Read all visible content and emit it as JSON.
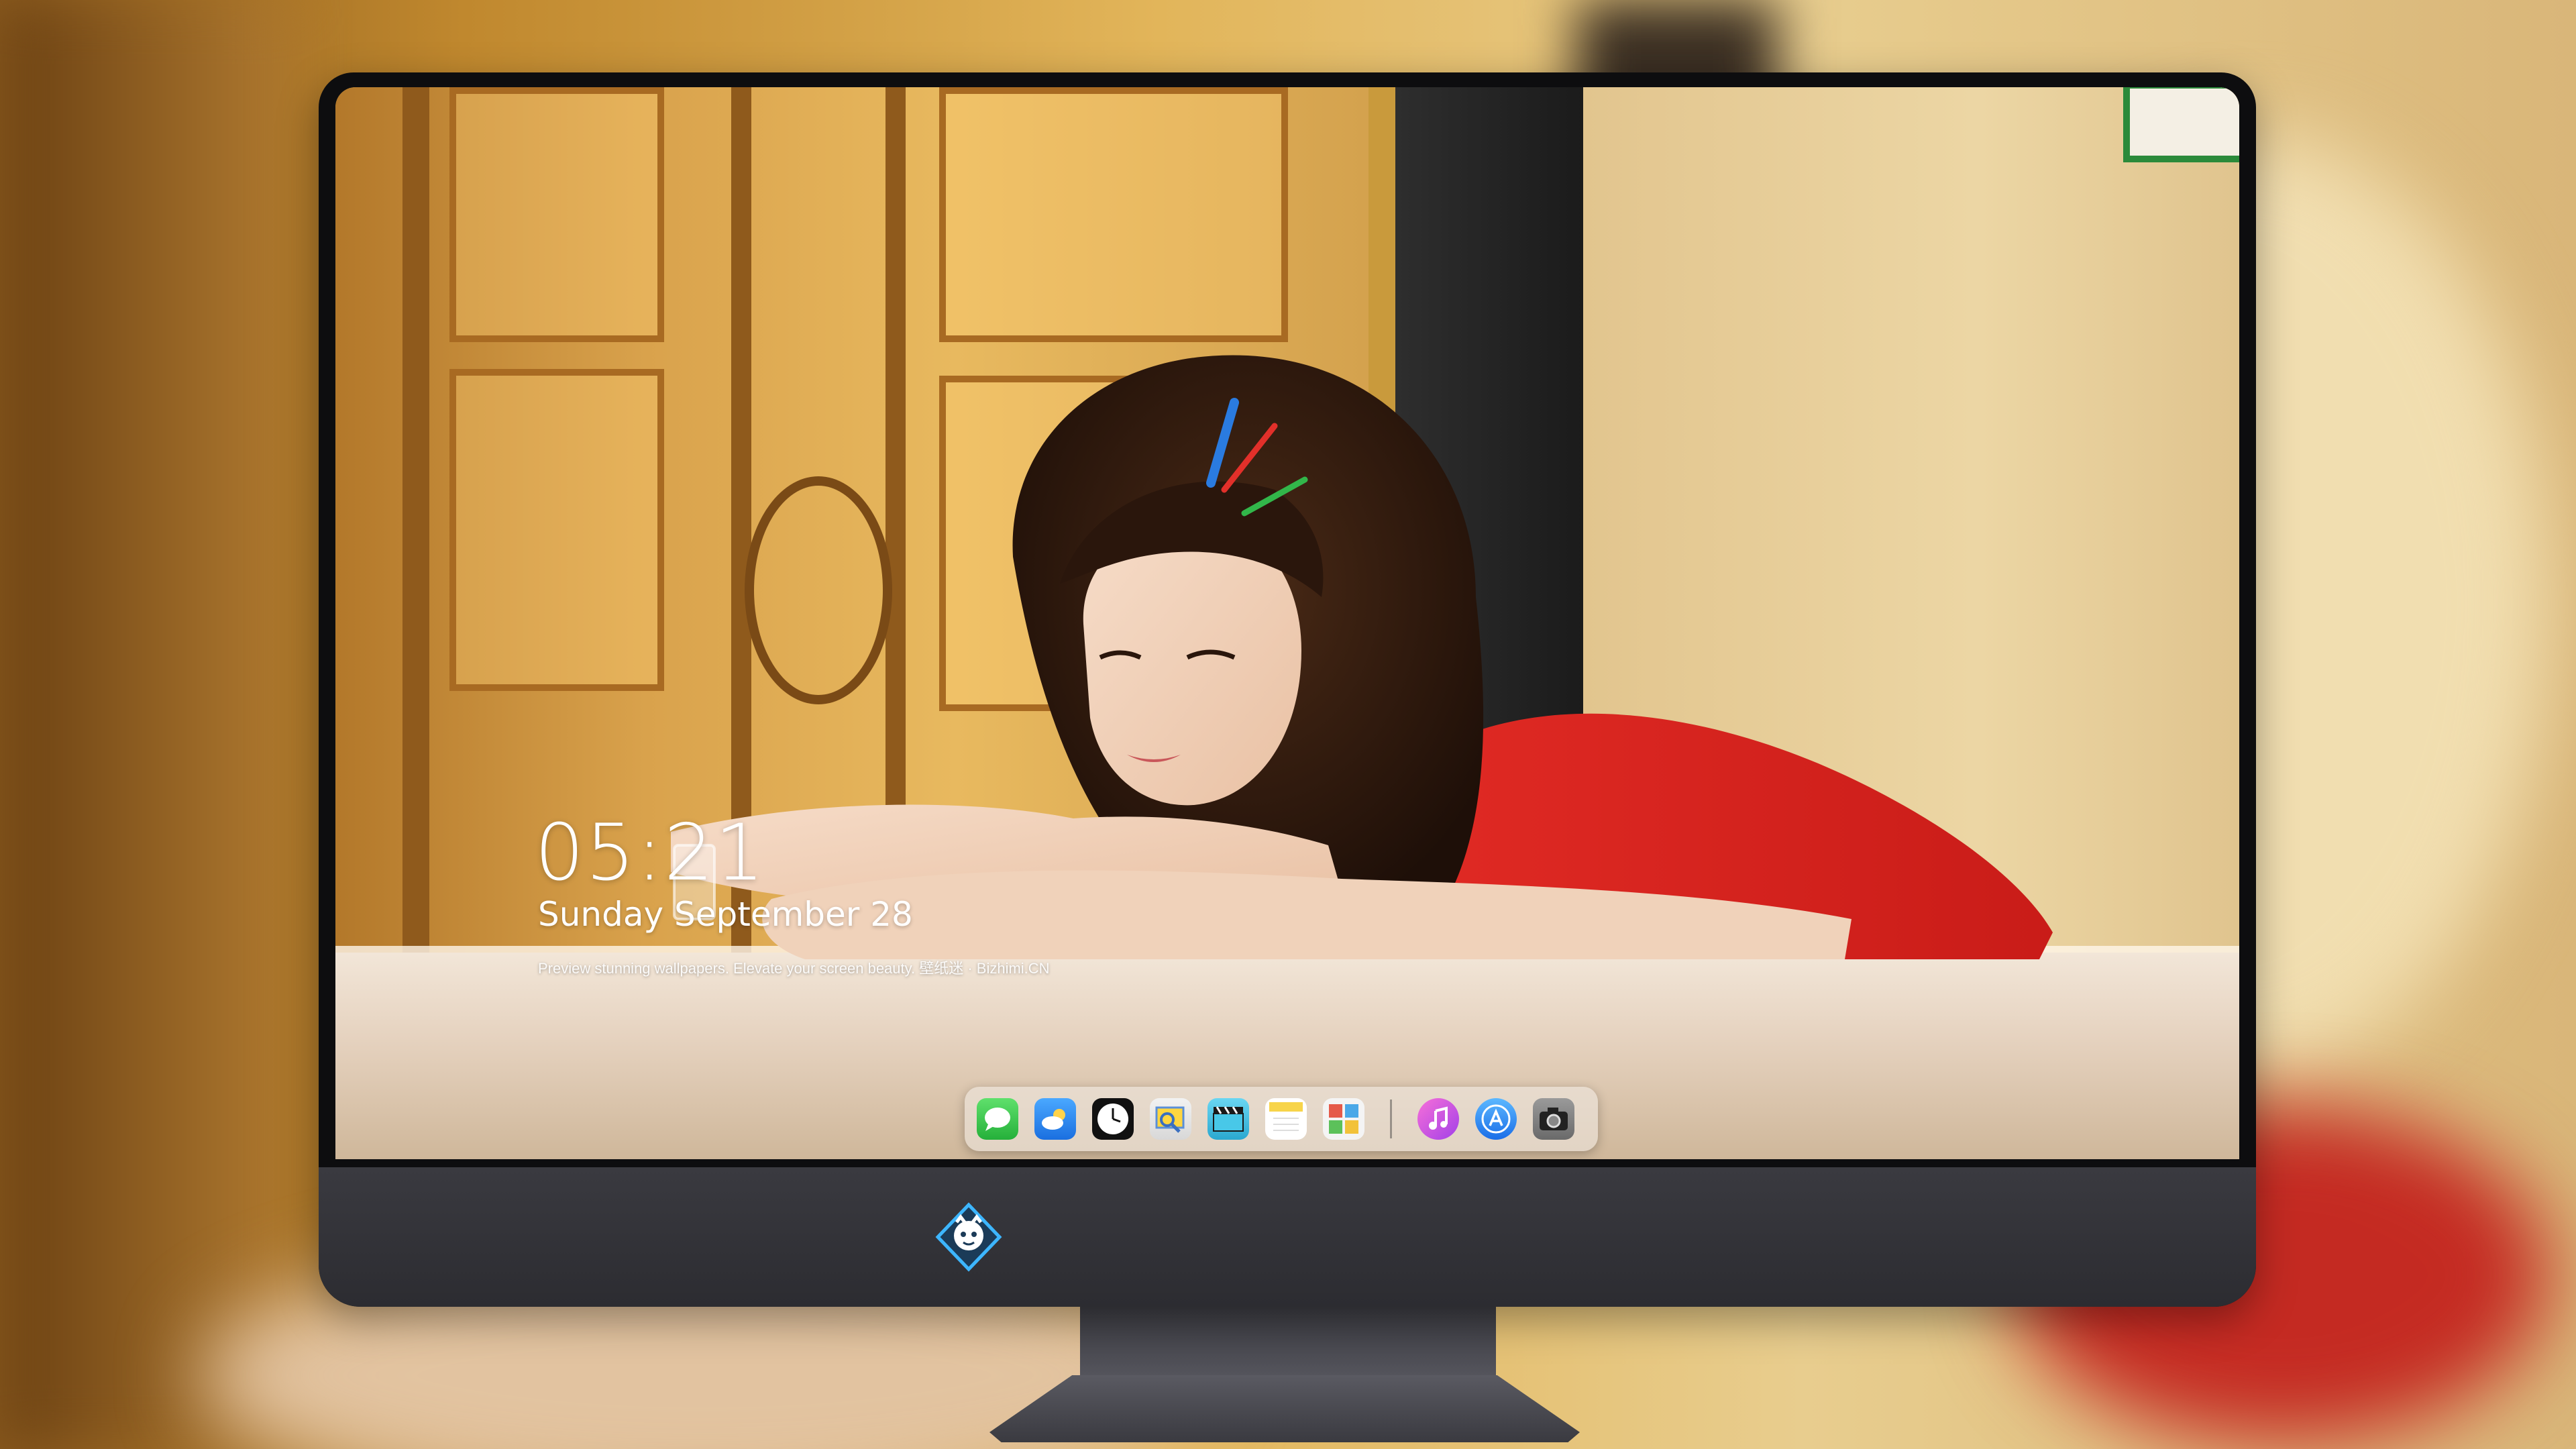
{
  "lockscreen": {
    "time": "05:21",
    "date": "Sunday September  28",
    "tagline": "Preview stunning wallpapers. Elevate your screen beauty. 壁纸迷 · Bizhimi.CN"
  },
  "dock": {
    "apps": [
      {
        "name": "messages-icon",
        "color": "#35c24b"
      },
      {
        "name": "weather-icon",
        "color": "#2f8cf0"
      },
      {
        "name": "clock-icon",
        "color": "#111111"
      },
      {
        "name": "preview-icon",
        "color": "#e9c23c"
      },
      {
        "name": "clips-icon",
        "color": "#43c6e4"
      },
      {
        "name": "notes-icon",
        "color": "#f7d44a"
      },
      {
        "name": "photo-booth-icon",
        "color": "#e55a4a"
      },
      {
        "name": "itunes-icon",
        "color": "#e84fd0"
      },
      {
        "name": "app-store-icon",
        "color": "#2a8df0"
      },
      {
        "name": "camera-icon",
        "color": "#8a8a8a"
      }
    ]
  },
  "colors": {
    "bezel": "#0d0d0f",
    "chin": "#333338",
    "shirt": "#d92020"
  }
}
